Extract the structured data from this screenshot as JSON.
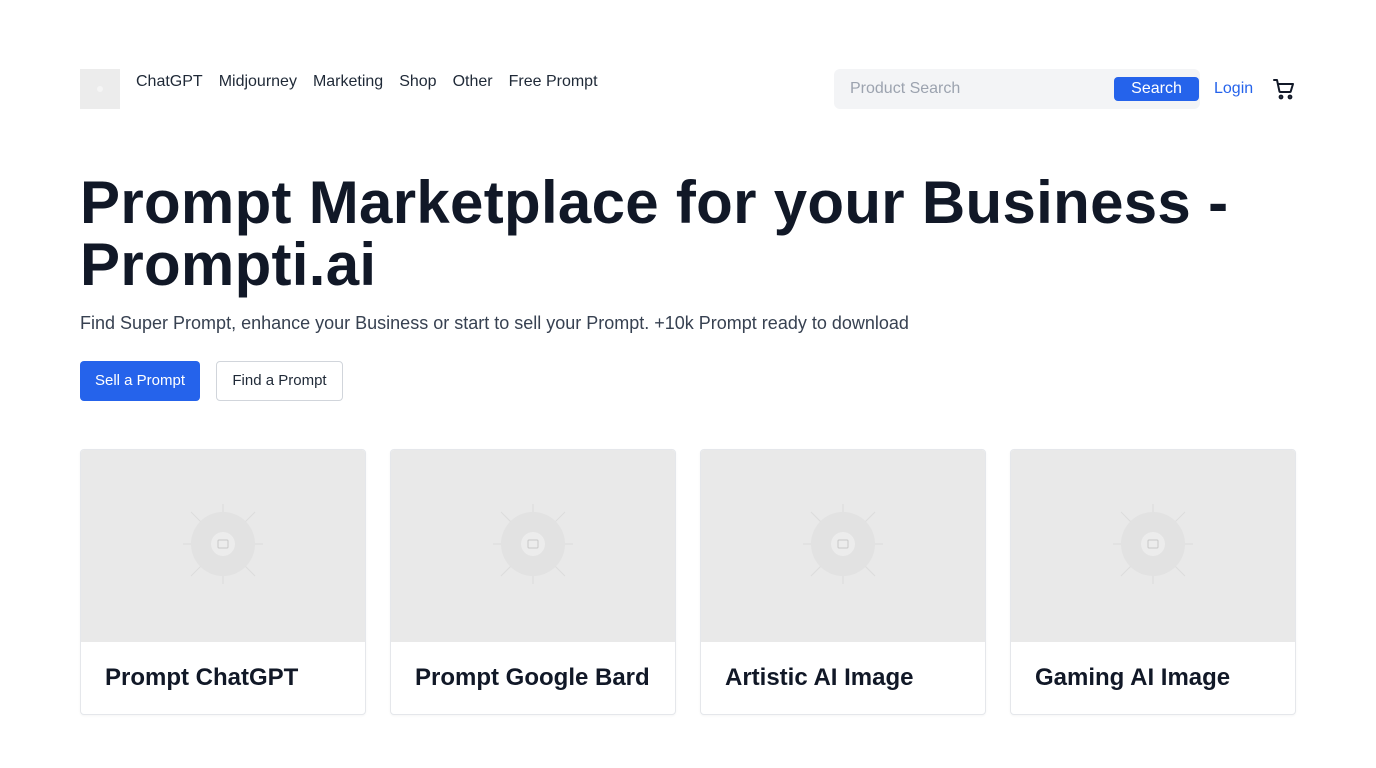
{
  "header": {
    "nav": [
      "ChatGPT",
      "Midjourney",
      "Marketing",
      "Shop",
      "Other",
      "Free Prompt"
    ],
    "search": {
      "placeholder": "Product Search",
      "value": "",
      "button_label": "Search"
    },
    "login_label": "Login",
    "icons": {
      "logo": "logo-placeholder-icon",
      "cart": "shopping-cart-icon"
    }
  },
  "hero": {
    "title": "Prompt Marketplace for your Business - Prompti.ai",
    "subtitle": "Find Super Prompt, enhance your Business or start to sell your Prompt. +10k Prompt ready to download",
    "primary_button": "Sell a Prompt",
    "secondary_button": "Find a Prompt"
  },
  "categories": [
    {
      "title": "Prompt ChatGPT",
      "image_icon": "image-placeholder-icon"
    },
    {
      "title": "Prompt Google Bard",
      "image_icon": "image-placeholder-icon"
    },
    {
      "title": "Artistic AI Image",
      "image_icon": "image-placeholder-icon"
    },
    {
      "title": "Gaming AI Image",
      "image_icon": "image-placeholder-icon"
    }
  ],
  "colors": {
    "accent": "#2563eb",
    "text": "#111827",
    "placeholder_bg": "#e9e9e9"
  }
}
